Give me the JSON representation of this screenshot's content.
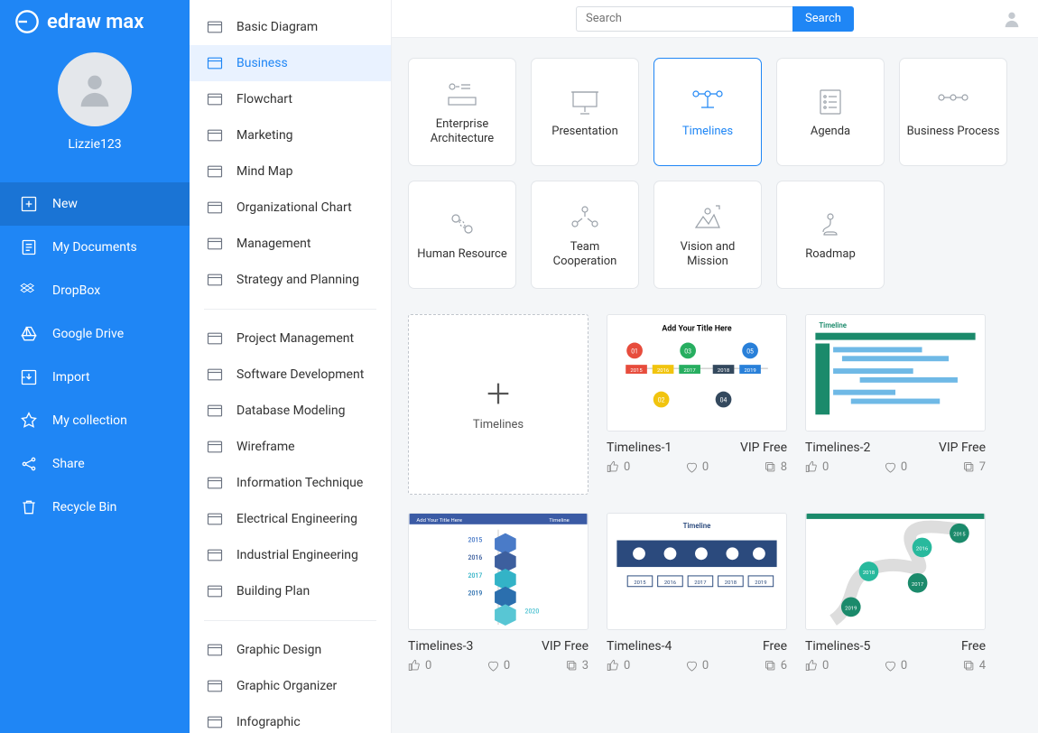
{
  "app_name": "edraw max",
  "username": "Lizzie123",
  "search": {
    "placeholder": "Search",
    "button": "Search"
  },
  "nav": [
    {
      "id": "new",
      "label": "New",
      "active": true
    },
    {
      "id": "my-documents",
      "label": "My Documents"
    },
    {
      "id": "dropbox",
      "label": "DropBox"
    },
    {
      "id": "google-drive",
      "label": "Google Drive"
    },
    {
      "id": "import",
      "label": "Import"
    },
    {
      "id": "my-collection",
      "label": "My collection"
    },
    {
      "id": "share",
      "label": "Share"
    },
    {
      "id": "recycle-bin",
      "label": "Recycle Bin"
    }
  ],
  "categories_group1": [
    {
      "id": "basic-diagram",
      "label": "Basic Diagram"
    },
    {
      "id": "business",
      "label": "Business",
      "active": true
    },
    {
      "id": "flowchart",
      "label": "Flowchart"
    },
    {
      "id": "marketing",
      "label": "Marketing"
    },
    {
      "id": "mind-map",
      "label": "Mind Map"
    },
    {
      "id": "organizational-chart",
      "label": "Organizational Chart"
    },
    {
      "id": "management",
      "label": "Management"
    },
    {
      "id": "strategy-and-planning",
      "label": "Strategy and Planning"
    }
  ],
  "categories_group2": [
    {
      "id": "project-management",
      "label": "Project Management"
    },
    {
      "id": "software-development",
      "label": "Software Development"
    },
    {
      "id": "database-modeling",
      "label": "Database Modeling"
    },
    {
      "id": "wireframe",
      "label": "Wireframe"
    },
    {
      "id": "information-technique",
      "label": "Information Technique"
    },
    {
      "id": "electrical-engineering",
      "label": "Electrical Engineering"
    },
    {
      "id": "industrial-engineering",
      "label": "Industrial Engineering"
    },
    {
      "id": "building-plan",
      "label": "Building Plan"
    }
  ],
  "categories_group3": [
    {
      "id": "graphic-design",
      "label": "Graphic Design"
    },
    {
      "id": "graphic-organizer",
      "label": "Graphic Organizer"
    },
    {
      "id": "infographic",
      "label": "Infographic"
    }
  ],
  "tiles": [
    {
      "id": "enterprise-architecture",
      "label": "Enterprise Architecture"
    },
    {
      "id": "presentation",
      "label": "Presentation"
    },
    {
      "id": "timelines",
      "label": "Timelines",
      "active": true
    },
    {
      "id": "agenda",
      "label": "Agenda"
    },
    {
      "id": "business-process",
      "label": "Business Process"
    },
    {
      "id": "human-resource",
      "label": "Human Resource"
    },
    {
      "id": "team-cooperation",
      "label": "Team Cooperation"
    },
    {
      "id": "vision-and-mission",
      "label": "Vision and Mission"
    },
    {
      "id": "roadmap",
      "label": "Roadmap"
    }
  ],
  "create_label": "Timelines",
  "templates": [
    {
      "id": "timelines-1",
      "name": "Timelines-1",
      "badge": "VIP Free",
      "likes": 0,
      "favs": 0,
      "copies": 8
    },
    {
      "id": "timelines-2",
      "name": "Timelines-2",
      "badge": "VIP Free",
      "likes": 0,
      "favs": 0,
      "copies": 7
    },
    {
      "id": "timelines-3",
      "name": "Timelines-3",
      "badge": "VIP Free",
      "likes": 0,
      "favs": 0,
      "copies": 3
    },
    {
      "id": "timelines-4",
      "name": "Timelines-4",
      "badge": "Free",
      "likes": 0,
      "favs": 0,
      "copies": 6
    },
    {
      "id": "timelines-5",
      "name": "Timelines-5",
      "badge": "Free",
      "likes": 0,
      "favs": 0,
      "copies": 4
    }
  ]
}
